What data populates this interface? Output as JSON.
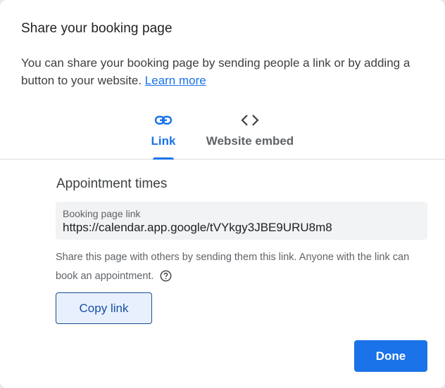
{
  "dialog": {
    "title": "Share your booking page",
    "description": "You can share your booking page by sending people a link or by adding a button to your website.",
    "learn_more": "Learn more"
  },
  "tabs": [
    {
      "label": "Link",
      "icon": "link-icon",
      "active": true
    },
    {
      "label": "Website embed",
      "icon": "code-icon",
      "active": false
    }
  ],
  "section": {
    "title": "Appointment times",
    "link_label": "Booking page link",
    "link_value": "https://calendar.app.google/tVYkgy3JBE9URU8m8",
    "help_text": "Share this page with others by sending them this link. Anyone with the link can book an appointment.",
    "help_icon": "help-circle-icon"
  },
  "buttons": {
    "copy_link": "Copy link",
    "done": "Done"
  },
  "colors": {
    "accent": "#1a73e8",
    "field_bg": "#f1f3f4",
    "copy_bg": "#e8f0fe"
  }
}
